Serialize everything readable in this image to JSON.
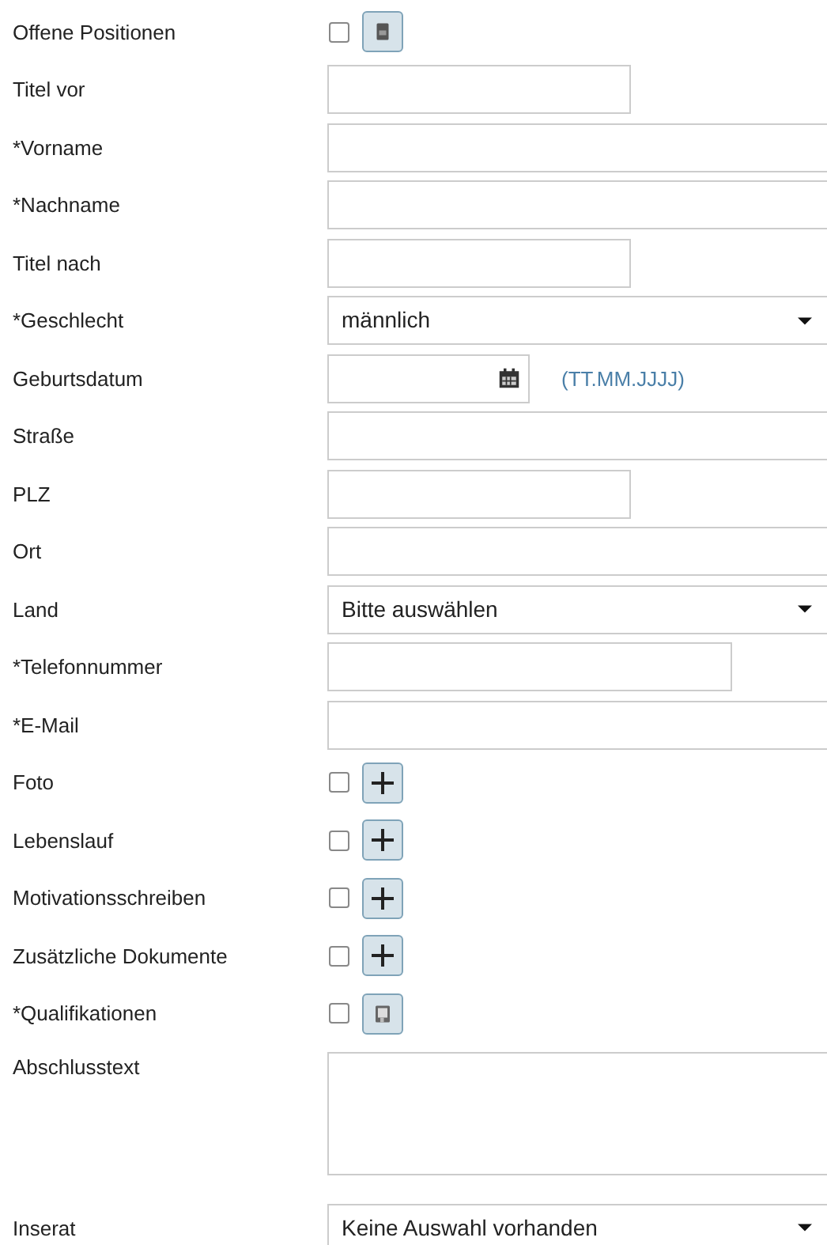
{
  "fields": [
    {
      "label": "Offene Positionen",
      "kind": "attach",
      "checked": false
    },
    {
      "label": "Titel vor",
      "kind": "text"
    },
    {
      "label": "*Vorname",
      "kind": "text"
    },
    {
      "label": "*Nachname",
      "kind": "text"
    },
    {
      "label": "Titel nach",
      "kind": "text"
    },
    {
      "label": "*Geschlecht",
      "kind": "select",
      "value": "männlich"
    },
    {
      "label": "Geburtsdatum",
      "kind": "date",
      "hint": "(TT.MM.JJJJ)"
    },
    {
      "label": "Straße",
      "kind": "text"
    },
    {
      "label": "PLZ",
      "kind": "text"
    },
    {
      "label": "Ort",
      "kind": "text"
    },
    {
      "label": "Land",
      "kind": "select",
      "value": "Bitte auswählen"
    },
    {
      "label": "*Telefonnummer",
      "kind": "text"
    },
    {
      "label": "*E-Mail",
      "kind": "text"
    },
    {
      "label": "Foto",
      "kind": "attach",
      "checked": false
    },
    {
      "label": "Lebenslauf",
      "kind": "attach",
      "checked": false
    },
    {
      "label": "Motivationsschreiben",
      "kind": "attach",
      "checked": false
    },
    {
      "label": "Zusätzliche Dokumente",
      "kind": "attach",
      "checked": false
    },
    {
      "label": "*Qualifikationen",
      "kind": "attach",
      "checked": false
    },
    {
      "label": "Abschlusstext",
      "kind": "textarea"
    },
    {
      "label": "Inserat",
      "kind": "select",
      "value": "Keine Auswahl vorhanden"
    }
  ]
}
